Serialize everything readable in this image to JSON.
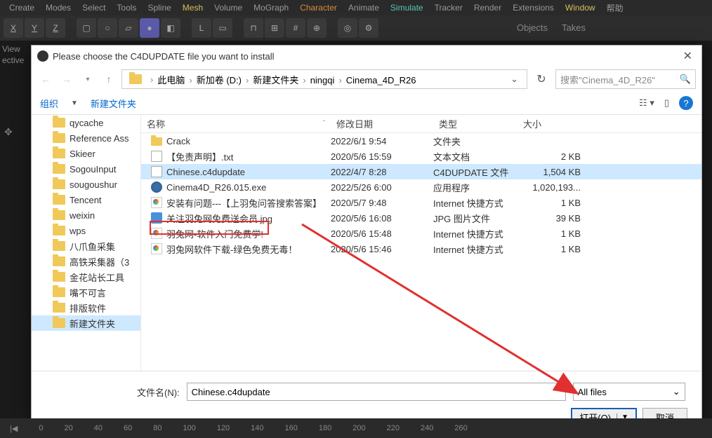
{
  "menu": {
    "items": [
      "Create",
      "Modes",
      "Select",
      "Tools",
      "Spline",
      "Mesh",
      "Volume",
      "MoGraph",
      "Character",
      "Animate",
      "Simulate",
      "Tracker",
      "Render",
      "Extensions",
      "Window",
      "帮助"
    ],
    "highlights": {
      "Mesh": "yellow",
      "Character": "orange",
      "Simulate": "teal",
      "Window": "yellow"
    }
  },
  "axis": [
    "X",
    "Y",
    "Z"
  ],
  "panel_tabs": {
    "objects": "Objects",
    "takes": "Takes"
  },
  "left": {
    "view": "View",
    "perspective": "ective"
  },
  "dialog": {
    "title": "Please choose the C4DUPDATE file you want to install",
    "breadcrumb": [
      "此电脑",
      "新加卷 (D:)",
      "新建文件夹",
      "ningqi",
      "Cinema_4D_R26"
    ],
    "search_placeholder": "搜索\"Cinema_4D_R26\"",
    "organize": "组织",
    "new_folder": "新建文件夹",
    "columns": {
      "name": "名称",
      "date": "修改日期",
      "type": "类型",
      "size": "大小"
    },
    "sidebar": [
      "qycache",
      "Reference Ass",
      "Skieer",
      "SogouInput",
      "sougoushur",
      "Tencent",
      "weixin",
      "wps",
      "八爪鱼采集",
      "高铁采集器（3",
      "金花站长工具",
      "嘴不可言",
      "排版软件",
      "新建文件夹"
    ],
    "sidebar_selected": 13,
    "files": [
      {
        "icon": "folder",
        "name": "Crack",
        "date": "2022/6/1 9:54",
        "type": "文件夹",
        "size": ""
      },
      {
        "icon": "txt",
        "name": "【免责声明】.txt",
        "date": "2020/5/6 15:59",
        "type": "文本文档",
        "size": "2 KB"
      },
      {
        "icon": "c4d",
        "name": "Chinese.c4dupdate",
        "date": "2022/4/7 8:28",
        "type": "C4DUPDATE 文件",
        "size": "1,504 KB",
        "selected": true
      },
      {
        "icon": "exe",
        "name": "Cinema4D_R26.015.exe",
        "date": "2022/5/26 6:00",
        "type": "应用程序",
        "size": "1,020,193..."
      },
      {
        "icon": "url",
        "name": "安装有问题---【上羽兔问答搜索答案】",
        "date": "2020/5/7 9:48",
        "type": "Internet 快捷方式",
        "size": "1 KB"
      },
      {
        "icon": "jpg",
        "name": "关注羽兔网免费送会员.jpg",
        "date": "2020/5/6 16:08",
        "type": "JPG 图片文件",
        "size": "39 KB"
      },
      {
        "icon": "url",
        "name": "羽兔网-软件入门免费学!",
        "date": "2020/5/6 15:48",
        "type": "Internet 快捷方式",
        "size": "1 KB"
      },
      {
        "icon": "url",
        "name": "羽兔网软件下载-绿色免费无毒！",
        "date": "2020/5/6 15:46",
        "type": "Internet 快捷方式",
        "size": "1 KB"
      }
    ],
    "filename_label": "文件名(N):",
    "filename_value": "Chinese.c4dupdate",
    "filter": "All files",
    "open": "打开(O)",
    "cancel": "取消"
  },
  "ruler_frames": [
    "0",
    "20",
    "40",
    "60",
    "80",
    "100",
    "120",
    "140",
    "160",
    "180",
    "200",
    "220",
    "240",
    "260"
  ]
}
